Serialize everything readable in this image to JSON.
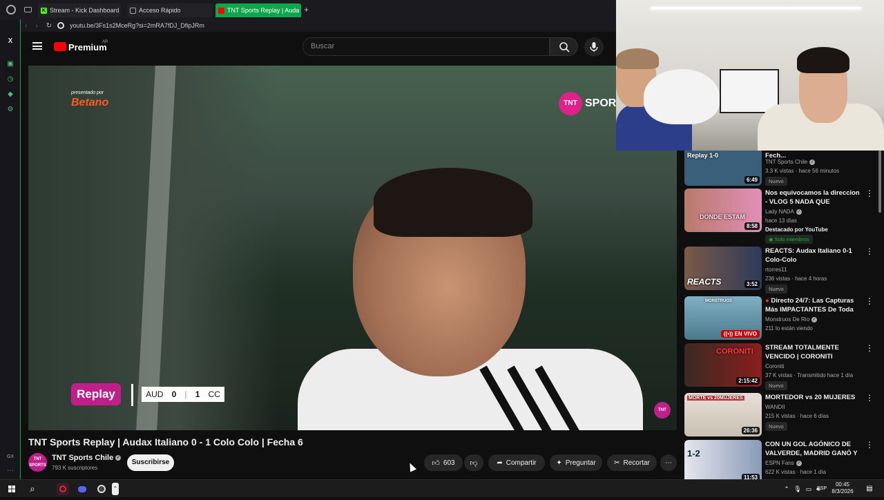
{
  "browser": {
    "tabs": [
      {
        "label": "Stream - Kick Dashboard",
        "icon": "kick-icon",
        "color": "#53fc18"
      },
      {
        "label": "Acceso Rápido",
        "icon": "grid-icon",
        "color": "#aaaaaa"
      },
      {
        "label": "TNT Sports Replay | Auda",
        "icon": "youtube-icon",
        "color": "#ff0000"
      }
    ],
    "new_tab": "+",
    "url": "youtu.be/3Fs1s2MceRg?si=2mRA7fDJ_DfipJRm",
    "accent": "#0ea64b"
  },
  "youtube": {
    "logo": "Premium",
    "region": "AR",
    "search_placeholder": "Buscar"
  },
  "video": {
    "sponsor_small": "presentado por",
    "sponsor": "Betano",
    "tnt_logo": "TNT",
    "tnt_word": "SPOR",
    "replay": "Replay",
    "score": {
      "home": "AUD",
      "home_goals": "0",
      "away_goals": "1",
      "away": "CC"
    },
    "small_logo": "TNT",
    "title": "TNT Sports Replay | Audax Italiano 0 - 1 Colo Colo | Fecha 6"
  },
  "channel": {
    "avatar": "TNT SPORTS",
    "name": "TNT Sports Chile",
    "subs": "793 K suscriptores",
    "subscribe": "Suscribirse"
  },
  "actions": {
    "likes": "603",
    "share": "Compartir",
    "ask": "Preguntar",
    "clip": "Recortar"
  },
  "recommendations": [
    {
      "title": "- 0 Universidad Católica | Fech...",
      "channel": "TNT Sports Chile",
      "verified": true,
      "meta": "3.3 K vistas · hace 56 minutos",
      "badge": "Nuevo",
      "duration": "6:49",
      "thumb_text": "Replay  1-0",
      "color": "#3a5f7a"
    },
    {
      "title": "Nos equivocamos la direccion - VLOG 5 NADA QUE OCULTAR",
      "channel": "Lady NADA",
      "verified": true,
      "meta": "hace 13 días",
      "meta2": "Destacado por YouTube",
      "badge": "Solo miembros",
      "duration": "8:58",
      "thumb_text": "DONDE ESTAM",
      "color": "#d4709a"
    },
    {
      "title": "REACTS: Audax Italiano 0-1 Colo-Colo",
      "channel": "rtorres11",
      "verified": false,
      "meta": "236 vistas · hace 4 horas",
      "badge": "Nuevo",
      "duration": "3:52",
      "thumb_text": "REACTS",
      "color": "#5a4a3a"
    },
    {
      "title": "Directo 24/7: Las Capturas Más IMPACTANTES De Toda L...",
      "channel": "Monstruos De Rio",
      "verified": true,
      "meta": "211 lo están viendo",
      "badge": "",
      "duration": "EN VIVO",
      "thumb_text": "MONSTRUOS",
      "color": "#4a7a8a",
      "live": true
    },
    {
      "title": "STREAM TOTALMENTE VENCIDO | CORONITI",
      "channel": "Coroniti",
      "verified": false,
      "meta": "37 K vistas · Transmitido hace 1 día",
      "badge": "Nuevo",
      "duration": "2:15:42",
      "thumb_text": "CORONITI",
      "color": "#7a1e1e"
    },
    {
      "title": "MORTEDOR vs 20 MUJERES",
      "channel": "WANDII",
      "verified": false,
      "meta": "215 K vistas · hace 6 días",
      "badge": "Nuevo",
      "duration": "26:36",
      "thumb_text": "MORTE vs 20MUJERES",
      "color": "#e8e0d8"
    },
    {
      "title": "CON UN GOL AGÓNICO DE VALVERDE, MADRID GANÓ Y ...",
      "channel": "ESPN Fans",
      "verified": true,
      "meta": "622 K vistas · hace 1 día",
      "badge": "",
      "duration": "11:53",
      "thumb_text": "1-2",
      "color": "#c6cad4"
    }
  ],
  "taskbar": {
    "time": "00:45",
    "date": "8/3/2026",
    "lang": "ESP"
  },
  "sidebar_label": "GX"
}
